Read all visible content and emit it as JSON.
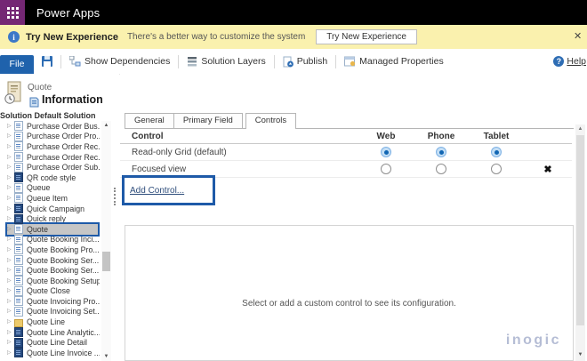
{
  "app": {
    "title": "Power Apps"
  },
  "notification": {
    "title": "Try New Experience",
    "message": "There's a better way to customize the system",
    "button": "Try New Experience",
    "close_icon": "✕"
  },
  "toolbar": {
    "file": "File",
    "show_dependencies": "Show Dependencies",
    "solution_layers": "Solution Layers",
    "publish": "Publish",
    "managed_properties": "Managed Properties",
    "help": "Help"
  },
  "sidebar": {
    "entity_name": "Quote",
    "view_title": "Information",
    "solution_label": "Solution Default Solution",
    "tree": [
      {
        "label": "Purchase Order Bus...",
        "icon": "doc",
        "state": ""
      },
      {
        "label": "Purchase Order Pro...",
        "icon": "doc",
        "state": ""
      },
      {
        "label": "Purchase Order Rec...",
        "icon": "doc",
        "state": ""
      },
      {
        "label": "Purchase Order Rec...",
        "icon": "doc",
        "state": ""
      },
      {
        "label": "Purchase Order Sub...",
        "icon": "doc",
        "state": ""
      },
      {
        "label": "QR code style",
        "icon": "dark",
        "state": ""
      },
      {
        "label": "Queue",
        "icon": "doc",
        "state": ""
      },
      {
        "label": "Queue Item",
        "icon": "doc",
        "state": ""
      },
      {
        "label": "Quick Campaign",
        "icon": "dark",
        "state": ""
      },
      {
        "label": "Quick reply",
        "icon": "dark",
        "state": ""
      },
      {
        "label": "Quote",
        "icon": "doc",
        "state": "selected"
      },
      {
        "label": "Quote Booking Inci...",
        "icon": "doc",
        "state": ""
      },
      {
        "label": "Quote Booking Pro...",
        "icon": "doc",
        "state": ""
      },
      {
        "label": "Quote Booking Ser...",
        "icon": "doc",
        "state": ""
      },
      {
        "label": "Quote Booking Ser...",
        "icon": "doc",
        "state": ""
      },
      {
        "label": "Quote Booking Setup",
        "icon": "doc",
        "state": ""
      },
      {
        "label": "Quote Close",
        "icon": "doc",
        "state": ""
      },
      {
        "label": "Quote Invoicing Pro...",
        "icon": "doc",
        "state": ""
      },
      {
        "label": "Quote Invoicing Set...",
        "icon": "doc",
        "state": ""
      },
      {
        "label": "Quote Line",
        "icon": "folder",
        "state": ""
      },
      {
        "label": "Quote Line Analytic...",
        "icon": "dark",
        "state": ""
      },
      {
        "label": "Quote Line Detail",
        "icon": "dark",
        "state": ""
      },
      {
        "label": "Quote Line Invoice ...",
        "icon": "dark",
        "state": ""
      }
    ]
  },
  "main": {
    "tabs": [
      {
        "label": "General",
        "state": ""
      },
      {
        "label": "Primary Field",
        "state": ""
      },
      {
        "label": "Controls",
        "state": "active"
      }
    ],
    "controls_table": {
      "headers": {
        "control": "Control",
        "web": "Web",
        "phone": "Phone",
        "tablet": "Tablet"
      },
      "rows": [
        {
          "name": "Read-only Grid (default)",
          "web": "checked",
          "phone": "checked",
          "tablet": "checked",
          "remove": ""
        },
        {
          "name": "Focused view",
          "web": "",
          "phone": "",
          "tablet": "",
          "remove": "✖"
        }
      ]
    },
    "add_control": "Add Control...",
    "empty_message": "Select or add a custom control to see its configuration.",
    "watermark": "inogic"
  },
  "colors": {
    "brand_purple": "#742774",
    "notification_yellow": "#faf1ae",
    "file_button_blue": "#1f62ac",
    "annotation_blue": "#1e5aa8",
    "radio_blue": "#1166b3"
  }
}
